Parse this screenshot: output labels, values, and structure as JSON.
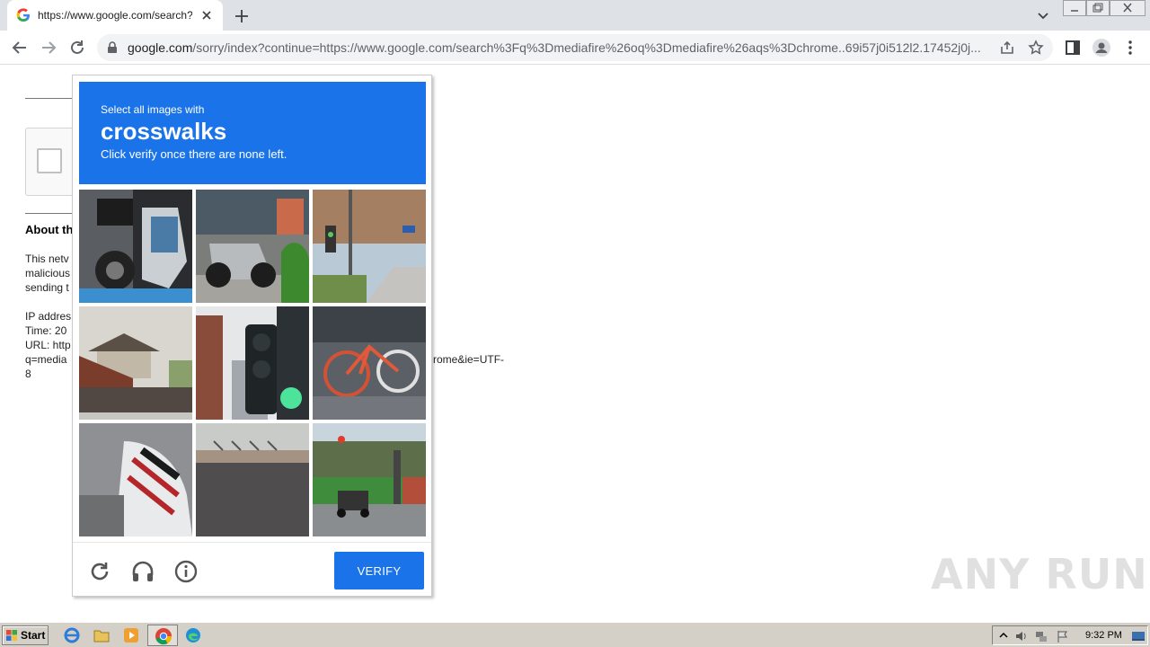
{
  "browser": {
    "tab_title": "https://www.google.com/search?q=",
    "url_host": "google.com",
    "url_rest": "/sorry/index?continue=https://www.google.com/search%3Fq%3Dmediafire%26oq%3Dmediafire%26aqs%3Dchrome..69i57j0i512l2.17452j0j...",
    "icons": [
      "back-icon",
      "forward-icon",
      "reload-icon",
      "lock-icon",
      "share-icon",
      "star-icon",
      "sidepanel-icon",
      "profile-icon",
      "menu-icon"
    ]
  },
  "page": {
    "about_title": "About th",
    "para_lines": [
      "This netv",
      "malicious",
      "sending t"
    ],
    "info_lines": [
      "IP addres",
      "Time: 20",
      "URL: http",
      "q=media",
      "8"
    ],
    "url_tail": "rome&ie=UTF-"
  },
  "challenge": {
    "prompt_small": "Select all images with",
    "prompt_big": "crosswalks",
    "prompt_sub": "Click verify once there are none left.",
    "tiles": [
      {
        "name": "motorcycle-tile"
      },
      {
        "name": "scooter-tile"
      },
      {
        "name": "street-traffic-light-tile"
      },
      {
        "name": "houses-fence-tile"
      },
      {
        "name": "traffic-light-green-tile"
      },
      {
        "name": "bicycle-tile"
      },
      {
        "name": "motorcycle-closeup-tile"
      },
      {
        "name": "pavement-tile"
      },
      {
        "name": "road-car-tile"
      }
    ],
    "verify_label": "VERIFY"
  },
  "watermark": "ANY RUN",
  "taskbar": {
    "start_label": "Start",
    "clock": "9:32 PM"
  },
  "colors": {
    "accent": "#1a73e8"
  }
}
